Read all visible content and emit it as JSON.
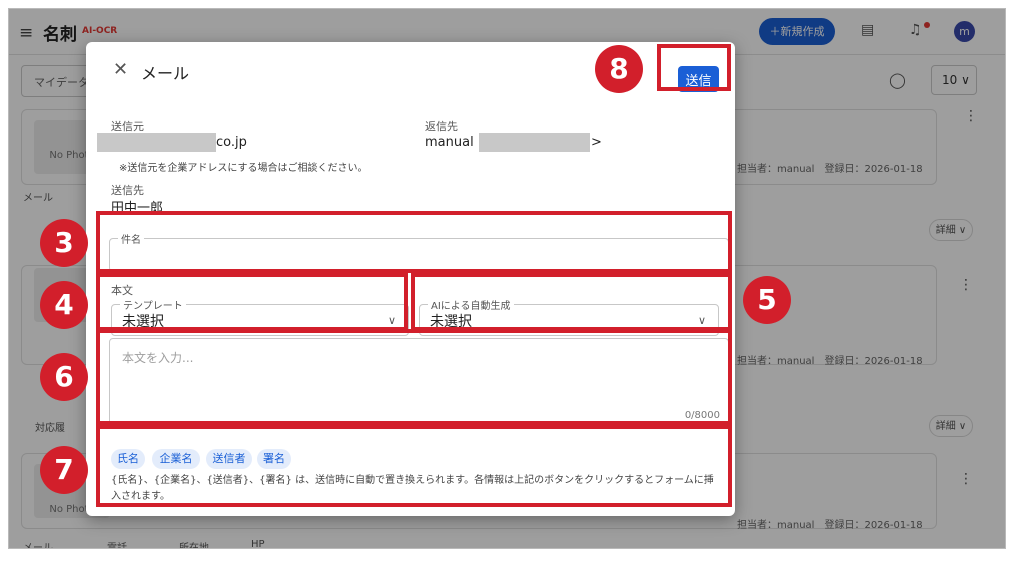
{
  "app": {
    "title": "名刺",
    "tag": "AI-OCR",
    "new_button": "＋新規作成",
    "avatar": "m",
    "search_placeholder": "マイデータ",
    "per_page": "10 ∨"
  },
  "cards": [
    {
      "photo": "No Photo",
      "meta": "担当者：manual　登録日：2026-01-18"
    },
    {
      "photo": "",
      "meta": "担当者：manual　登録日：2026-01-18"
    },
    {
      "photo": "No Photo",
      "meta": "担当者：manual　登録日：2026-01-18"
    }
  ],
  "bg_labels": {
    "mail_chip": "メール",
    "detail": "詳細 ∨",
    "response": "対応履",
    "bottom_chips": [
      "メール",
      "電話",
      "所在地",
      "HP"
    ]
  },
  "modal": {
    "title": "メール",
    "send_label": "送信",
    "from_label": "送信元",
    "from_value": "co.jp",
    "from_note": "※送信元を企業アドレスにする場合はご相談ください。",
    "reply_label": "返信先",
    "reply_value_prefix": "manual <",
    "reply_value_suffix": ">",
    "to_label": "送信先",
    "to_value": "田中一郎",
    "subject_label": "件名",
    "subject_value": "",
    "body_label": "本文",
    "template_label": "テンプレート",
    "template_value": "未選択",
    "ai_label": "AIによる自動生成",
    "ai_value": "未選択",
    "body_placeholder": "本文を入力...",
    "counter": "0/8000",
    "chips": [
      "氏名",
      "企業名",
      "送信者",
      "署名"
    ],
    "help_text": "{氏名}、{企業名}、{送信者}、{署名} は、送信時に自動で置き換えられます。各情報は上記のボタンをクリックするとフォームに挿入されます。"
  },
  "annotations": [
    "8",
    "3",
    "4",
    "5",
    "6",
    "7"
  ],
  "colors": {
    "accent": "#1a5fd6",
    "annotation": "#d21f2b"
  }
}
